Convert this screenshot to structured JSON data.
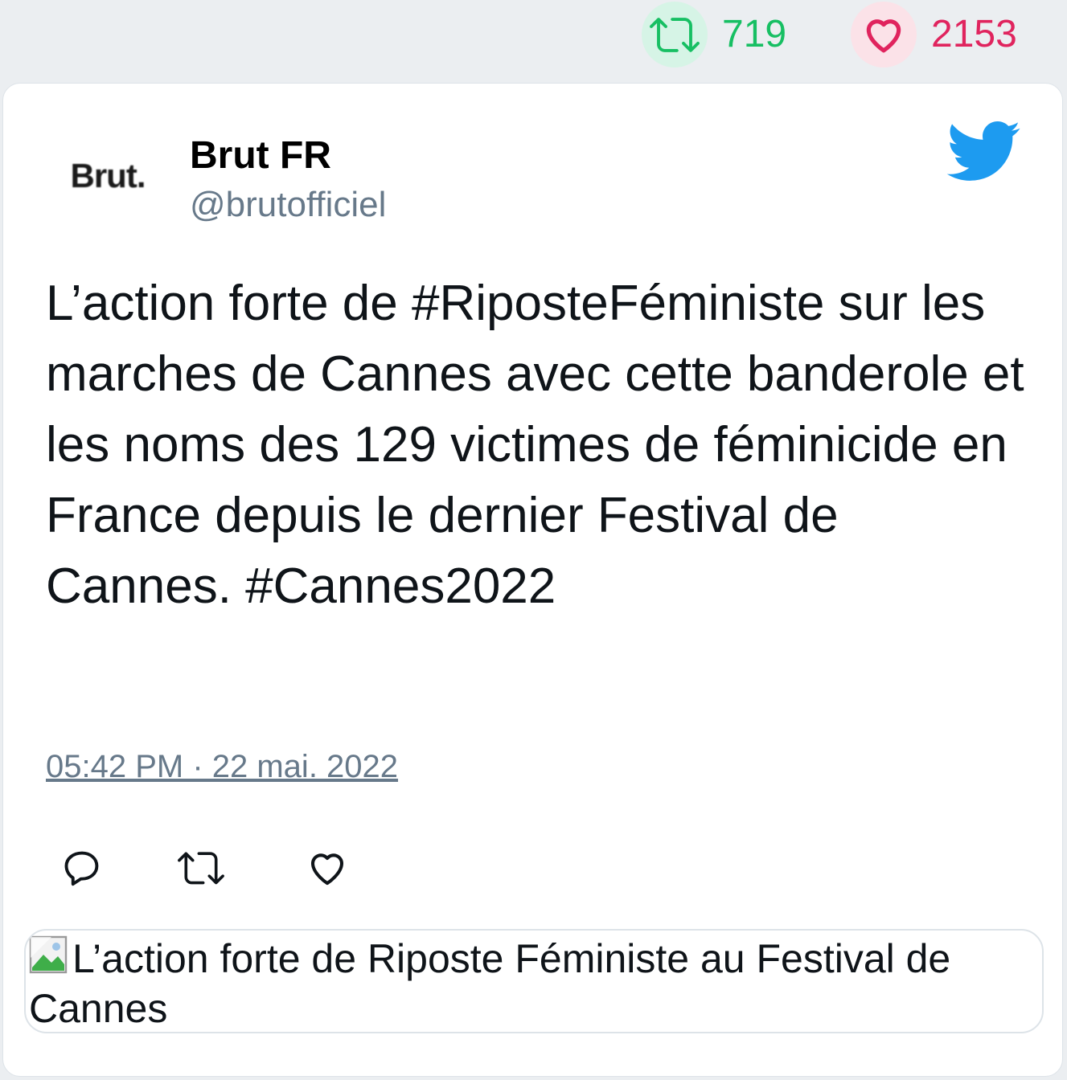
{
  "stats": {
    "retweet_count": "719",
    "like_count": "2153",
    "retweet_icon": "retweet-icon",
    "like_icon": "heart-icon",
    "retweet_color": "#17bf63",
    "like_color": "#e0245e"
  },
  "tweet": {
    "avatar_text": "Brut.",
    "author_name": "Brut FR",
    "author_handle": "@brutofficiel",
    "brand_icon": "twitter-bird-icon",
    "brand_color": "#1d9bf0",
    "text": "L’action forte de #RiposteFéministe sur les marches de Cannes avec cette banderole et les noms des 129 victimes de féminicide en France depuis le dernier Festival de Cannes. #Cannes2022",
    "timestamp": "05:42 PM · 22 mai. 2022",
    "actions": {
      "reply_icon": "reply-icon",
      "retweet_icon": "retweet-icon",
      "like_icon": "heart-icon"
    },
    "media_alt": "L’action forte de Riposte Féministe au Festival de Cannes"
  }
}
